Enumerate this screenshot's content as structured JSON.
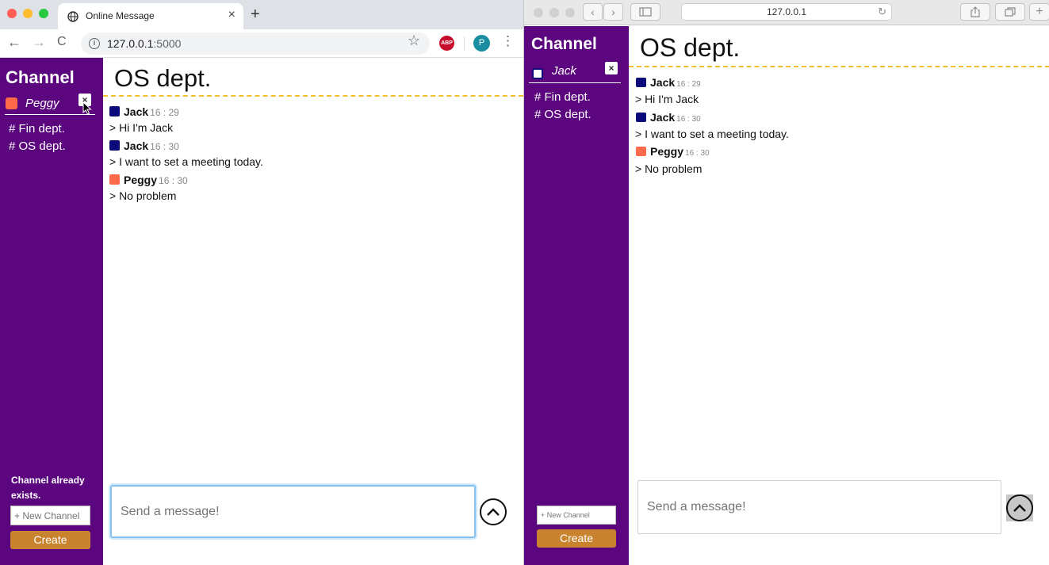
{
  "left_browser": {
    "tab": {
      "title": "Online Message",
      "close": "×"
    },
    "new_tab": "+",
    "url_host": "127.0.0.1",
    "url_port": ":5000",
    "info": "i",
    "abp": "ABP",
    "profile_initial": "P",
    "nav": {
      "back": "←",
      "forward": "→",
      "reload": "C"
    },
    "star": "☆",
    "menu": "⋮"
  },
  "right_browser": {
    "url": "127.0.0.1",
    "reload": "↻",
    "nav": {
      "back": "‹",
      "forward": "›"
    }
  },
  "app_left": {
    "sidebar_title": "Channel",
    "user": {
      "name": "Peggy",
      "color": "#ff6b4a"
    },
    "logout": "×",
    "channels": [
      "# Fin dept.",
      "# OS dept."
    ],
    "error": "Channel already exists.",
    "new_channel_placeholder": "+ New Channel",
    "create_label": "Create",
    "main_title": "OS dept.",
    "messages": [
      {
        "author": "Jack",
        "time": "16 : 29",
        "text": "> Hi I'm Jack",
        "color": "#0a0a7a"
      },
      {
        "author": "Jack",
        "time": "16 : 30",
        "text": "> I want to set a meeting today.",
        "color": "#0a0a7a"
      },
      {
        "author": "Peggy",
        "time": "16 : 30",
        "text": "> No problem",
        "color": "#ff6b4a"
      }
    ],
    "input_placeholder": "Send a message!"
  },
  "app_right": {
    "sidebar_title": "Channel",
    "user": {
      "name": "Jack",
      "color": "#0a0a7a"
    },
    "logout": "×",
    "channels": [
      "# Fin dept.",
      "# OS dept."
    ],
    "new_channel_placeholder": "+ New Channel",
    "create_label": "Create",
    "main_title": "OS dept.",
    "messages": [
      {
        "author": "Jack",
        "time": "16 : 29",
        "text": "> Hi I'm Jack",
        "color": "#0a0a7a"
      },
      {
        "author": "Jack",
        "time": "16 : 30",
        "text": "> I want to set a meeting today.",
        "color": "#0a0a7a"
      },
      {
        "author": "Peggy",
        "time": "16 : 30",
        "text": "> No problem",
        "color": "#ff6b4a"
      }
    ],
    "input_placeholder": "Send a message!"
  }
}
